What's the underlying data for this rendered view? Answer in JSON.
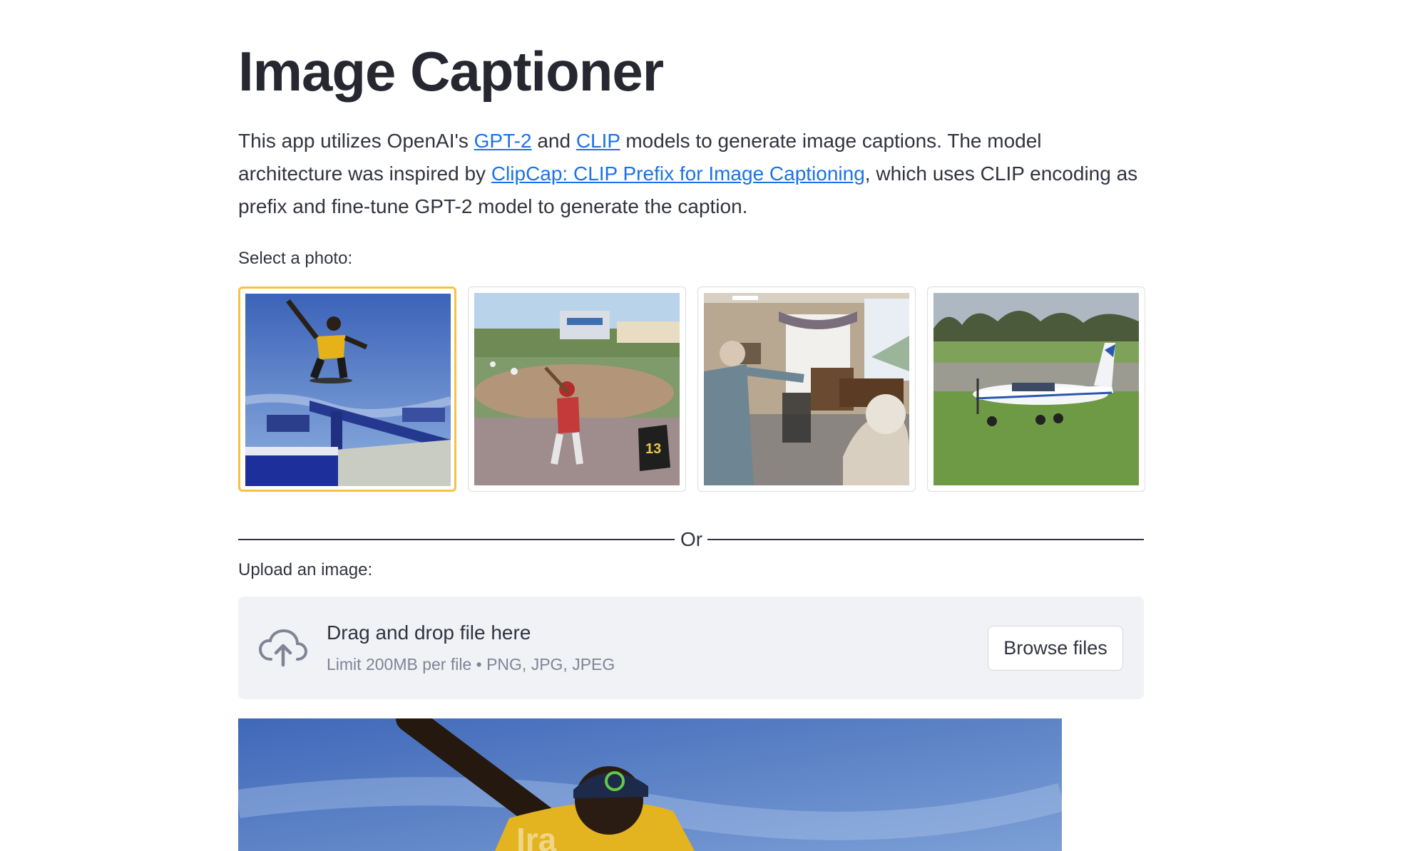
{
  "page": {
    "title": "Image Captioner",
    "intro": {
      "part1": "This app utilizes OpenAI's ",
      "link_gpt2": "GPT-2",
      "part2": " and ",
      "link_clip": "CLIP",
      "part3": " models to generate image captions. The model architecture was inspired by ",
      "link_clipcap": "ClipCap: CLIP Prefix for Image Captioning",
      "part4": ", which uses CLIP encoding as prefix and fine-tune GPT-2 model to generate the caption."
    }
  },
  "gallery": {
    "label": "Select a photo:",
    "selected_index": 0,
    "photos": [
      {
        "subject": "skateboarder-on-rail"
      },
      {
        "subject": "baseball-batter"
      },
      {
        "subject": "elderly-people-bowling-video-game"
      },
      {
        "subject": "small-airplane-on-grass-airfield"
      }
    ]
  },
  "divider": {
    "text": "Or"
  },
  "uploader": {
    "label": "Upload an image:",
    "drag_text": "Drag and drop file here",
    "limit_text": "Limit 200MB per file • PNG, JPG, JPEG",
    "browse_label": "Browse files",
    "icon": "cloud-upload-icon"
  },
  "colors": {
    "accent_selected": "#f5c244",
    "link": "#1a73e8",
    "dropzone_bg": "#f0f2f6",
    "text": "#31333f"
  }
}
